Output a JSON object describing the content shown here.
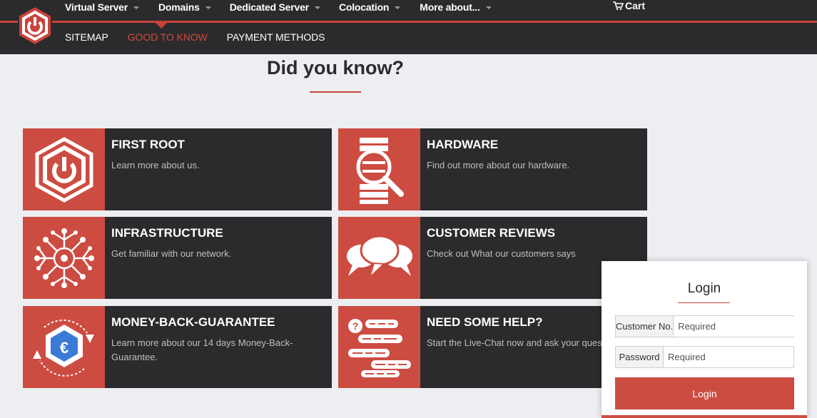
{
  "nav": {
    "main_items": [
      {
        "label": "Virtual Server"
      },
      {
        "label": "Domains"
      },
      {
        "label": "Dedicated Server"
      },
      {
        "label": "Colocation"
      },
      {
        "label": "More about..."
      }
    ],
    "cart_label": "Cart",
    "sub_items": [
      {
        "label": "SITEMAP",
        "active": false
      },
      {
        "label": "GOOD TO KNOW",
        "active": true
      },
      {
        "label": "PAYMENT METHODS",
        "active": false
      }
    ]
  },
  "headline": "Did you know?",
  "cards": [
    {
      "title": "FIRST ROOT",
      "desc": "Learn more about us.",
      "icon": "power-hexagon-icon"
    },
    {
      "title": "HARDWARE",
      "desc": "Find out more about our hardware.",
      "icon": "hardware-magnifier-icon"
    },
    {
      "title": "INFRASTRUCTURE",
      "desc": "Get familiar with our network.",
      "icon": "network-icon"
    },
    {
      "title": "CUSTOMER REVIEWS",
      "desc": "Check out What our customers says",
      "icon": "speech-bubbles-icon"
    },
    {
      "title": "MONEY-BACK-GUARANTEE",
      "desc": "Learn more about our 14 days Money-Back-Guarantee.",
      "icon": "euro-refund-icon"
    },
    {
      "title": "NEED SOME HELP?",
      "desc": "Start the Live-Chat now and ask your questions",
      "icon": "chat-help-icon"
    }
  ],
  "login": {
    "title": "Login",
    "customer_label": "Customer No.",
    "customer_placeholder": "Required",
    "password_label": "Password",
    "password_placeholder": "Required",
    "button_label": "Login"
  },
  "colors": {
    "accent": "#cc4c42",
    "dark": "#2b2b2d",
    "background": "#eceef1"
  }
}
